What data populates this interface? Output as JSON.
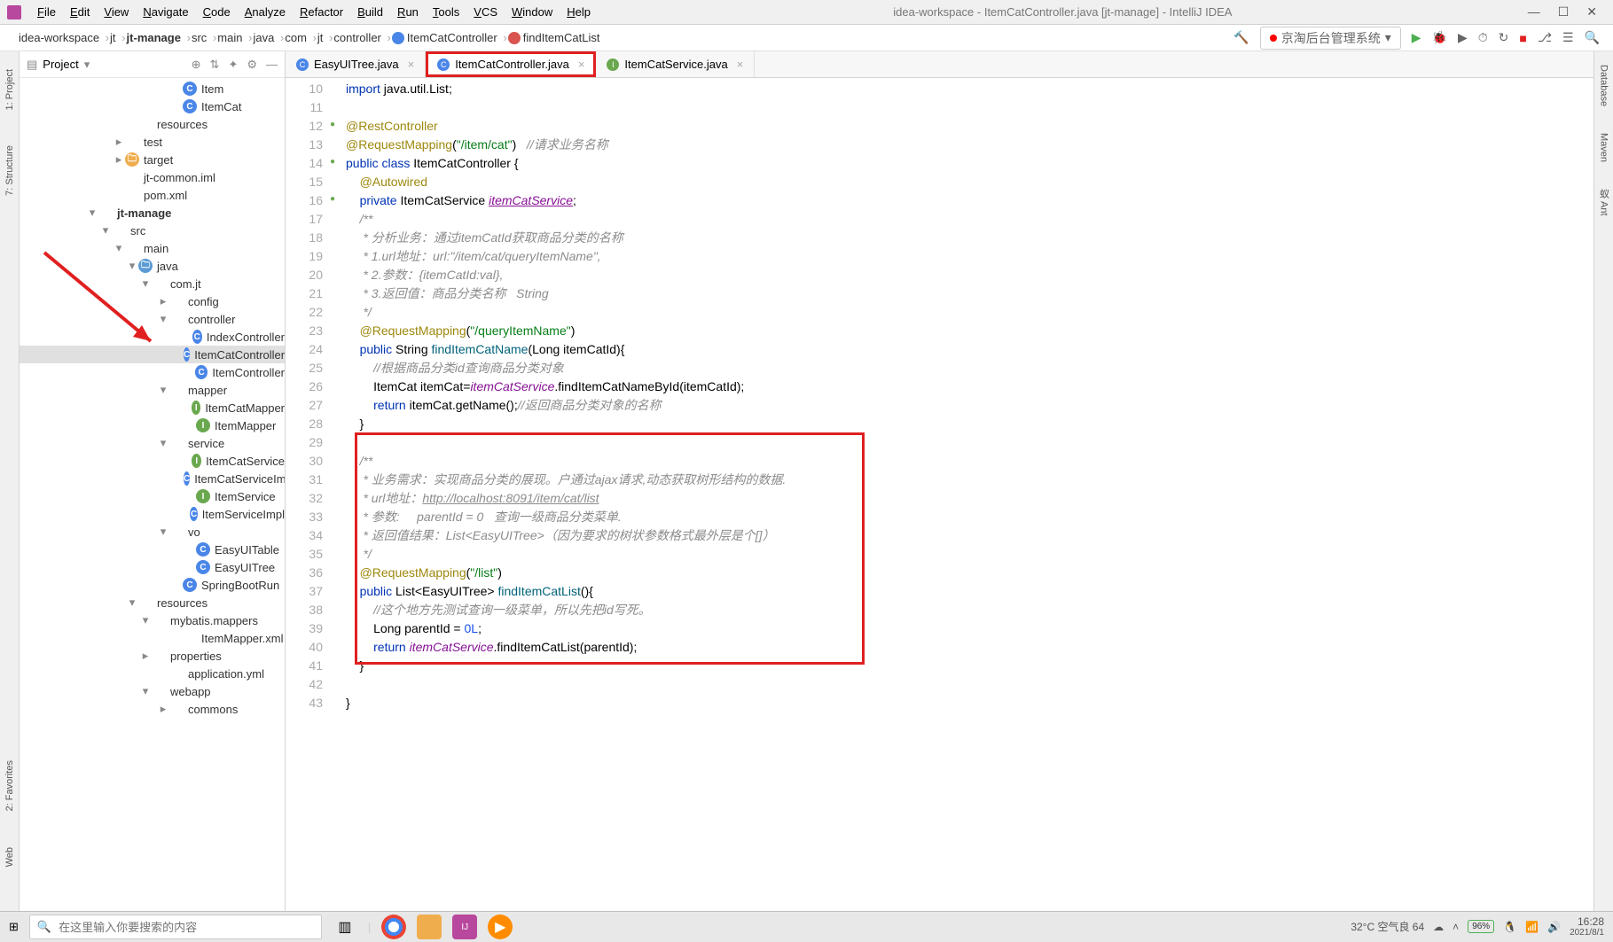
{
  "title": "idea-workspace - ItemCatController.java [jt-manage] - IntelliJ IDEA",
  "menus": [
    "File",
    "Edit",
    "View",
    "Navigate",
    "Code",
    "Analyze",
    "Refactor",
    "Build",
    "Run",
    "Tools",
    "VCS",
    "Window",
    "Help"
  ],
  "breadcrumbs": [
    "idea-workspace",
    "jt",
    "jt-manage",
    "src",
    "main",
    "java",
    "com",
    "jt",
    "controller",
    "ItemCatController",
    "findItemCatList"
  ],
  "run_config": "京淘后台管理系统",
  "project_label": "Project",
  "tree": [
    {
      "pad": 170,
      "arrow": "",
      "type": "class",
      "label": "Item"
    },
    {
      "pad": 170,
      "arrow": "",
      "type": "class",
      "label": "ItemCat"
    },
    {
      "pad": 120,
      "arrow": "",
      "type": "folder",
      "label": "resources"
    },
    {
      "pad": 105,
      "arrow": "▸",
      "type": "folder",
      "label": "test"
    },
    {
      "pad": 105,
      "arrow": "▸",
      "type": "orange",
      "label": "target"
    },
    {
      "pad": 105,
      "arrow": "",
      "type": "xml",
      "label": "jt-common.iml"
    },
    {
      "pad": 105,
      "arrow": "",
      "type": "xml",
      "label": "pom.xml"
    },
    {
      "pad": 75,
      "arrow": "▾",
      "type": "folder",
      "label": "jt-manage",
      "bold": true
    },
    {
      "pad": 90,
      "arrow": "▾",
      "type": "folder",
      "label": "src"
    },
    {
      "pad": 105,
      "arrow": "▾",
      "type": "folder",
      "label": "main"
    },
    {
      "pad": 120,
      "arrow": "▾",
      "type": "dir-blue",
      "label": "java"
    },
    {
      "pad": 135,
      "arrow": "▾",
      "type": "folder",
      "label": "com.jt"
    },
    {
      "pad": 155,
      "arrow": "▸",
      "type": "folder",
      "label": "config"
    },
    {
      "pad": 155,
      "arrow": "▾",
      "type": "folder",
      "label": "controller"
    },
    {
      "pad": 185,
      "arrow": "",
      "type": "class",
      "label": "IndexController"
    },
    {
      "pad": 185,
      "arrow": "",
      "type": "class",
      "label": "ItemCatController",
      "sel": true
    },
    {
      "pad": 185,
      "arrow": "",
      "type": "class",
      "label": "ItemController"
    },
    {
      "pad": 155,
      "arrow": "▾",
      "type": "folder",
      "label": "mapper"
    },
    {
      "pad": 185,
      "arrow": "",
      "type": "iface",
      "label": "ItemCatMapper"
    },
    {
      "pad": 185,
      "arrow": "",
      "type": "iface",
      "label": "ItemMapper"
    },
    {
      "pad": 155,
      "arrow": "▾",
      "type": "folder",
      "label": "service"
    },
    {
      "pad": 185,
      "arrow": "",
      "type": "iface",
      "label": "ItemCatService"
    },
    {
      "pad": 185,
      "arrow": "",
      "type": "class",
      "label": "ItemCatServiceImpl"
    },
    {
      "pad": 185,
      "arrow": "",
      "type": "iface",
      "label": "ItemService"
    },
    {
      "pad": 185,
      "arrow": "",
      "type": "class",
      "label": "ItemServiceImpl"
    },
    {
      "pad": 155,
      "arrow": "▾",
      "type": "folder",
      "label": "vo"
    },
    {
      "pad": 185,
      "arrow": "",
      "type": "class",
      "label": "EasyUITable"
    },
    {
      "pad": 185,
      "arrow": "",
      "type": "class",
      "label": "EasyUITree"
    },
    {
      "pad": 170,
      "arrow": "",
      "type": "class",
      "label": "SpringBootRun"
    },
    {
      "pad": 120,
      "arrow": "▾",
      "type": "folder",
      "label": "resources"
    },
    {
      "pad": 135,
      "arrow": "▾",
      "type": "folder",
      "label": "mybatis.mappers"
    },
    {
      "pad": 170,
      "arrow": "",
      "type": "xml",
      "label": "ItemMapper.xml"
    },
    {
      "pad": 135,
      "arrow": "▸",
      "type": "folder",
      "label": "properties"
    },
    {
      "pad": 155,
      "arrow": "",
      "type": "xml",
      "label": "application.yml"
    },
    {
      "pad": 135,
      "arrow": "▾",
      "type": "folder",
      "label": "webapp"
    },
    {
      "pad": 155,
      "arrow": "▸",
      "type": "folder",
      "label": "commons"
    }
  ],
  "tabs": [
    {
      "label": "EasyUITree.java",
      "type": "class"
    },
    {
      "label": "ItemCatController.java",
      "type": "class",
      "active": true,
      "boxed": true
    },
    {
      "label": "ItemCatService.java",
      "type": "iface"
    }
  ],
  "code_lines_start": 10,
  "code": [
    "<span class='kw2'>import</span> java.util.List;",
    "",
    "<span class='anno'>@RestController</span>",
    "<span class='anno'>@RequestMapping</span>(<span class='str'>\"/item/cat\"</span>)   <span class='com'>//请求业务名称</span>",
    "<span class='kw2'>public class</span> ItemCatController {",
    "    <span class='anno'>@Autowired</span>",
    "    <span class='kw2'>private</span> ItemCatService <span class='fld und'>itemCatService</span>;",
    "    <span class='com'>/**</span>",
    "<span class='com'>     * 分析业务：通过itemCatId获取商品分类的名称</span>",
    "<span class='com'>     * 1.url地址：url:\"/item/cat/queryItemName\",</span>",
    "<span class='com'>     * 2.参数：{itemCatId:val},</span>",
    "<span class='com'>     * 3.返回值：商品分类名称   String</span>",
    "<span class='com'>     */</span>",
    "    <span class='anno'>@RequestMapping</span>(<span class='str'>\"/queryItemName\"</span>)",
    "    <span class='kw2'>public</span> String <span class='fn'>findItemCatName</span>(Long itemCatId){",
    "        <span class='com'>//根据商品分类id查询商品分类对象</span>",
    "        ItemCat itemCat=<span class='fld'>itemCatService</span>.findItemCatNameById(itemCatId);",
    "        <span class='kw2'>return</span> itemCat.getName();<span class='com'>//返回商品分类对象的名称</span>",
    "    }",
    "",
    "    <span class='com'>/**</span>",
    "<span class='com'>     * 业务需求：实现商品分类的展现。户通过ajax请求,动态获取树形结构的数据.</span>",
    "<span class='com'>     * url地址：<span class='und'>http://localhost:8091/item/cat/list</span></span>",
    "<span class='com'>     * 参数:     parentId = 0   查询一级商品分类菜单.</span>",
    "<span class='com'>     * 返回值结果：List&lt;EasyUITree&gt;（因为要求的树状参数格式最外层是个[]）</span>",
    "<span class='com'>     */</span>",
    "    <span class='anno'>@RequestMapping</span>(<span class='str'>\"/list\"</span>)",
    "    <span class='kw2'>public</span> List&lt;EasyUITree&gt; <span class='fn'>findItemCatList</span>(){",
    "        <span class='com'>//这个地方先测试查询一级菜单，所以先把id写死。</span>",
    "        Long parentId = <span class='num'>0L</span>;",
    "        <span class='kw2'>return</span> <span class='fld'>itemCatService</span>.findItemCatList(parentId);",
    "    }",
    "",
    "}"
  ],
  "left_rails": [
    "1: Project",
    "7: Structure"
  ],
  "left_rails_bottom": [
    "2: Favorites",
    "Web"
  ],
  "right_rails": [
    "Database",
    "Maven",
    "蚁 Ant"
  ],
  "search_placeholder": "在这里输入你要搜索的内容",
  "weather": "32°C 空气良 64",
  "battery": "96%",
  "time": "16:28",
  "date": "2021/8/1"
}
